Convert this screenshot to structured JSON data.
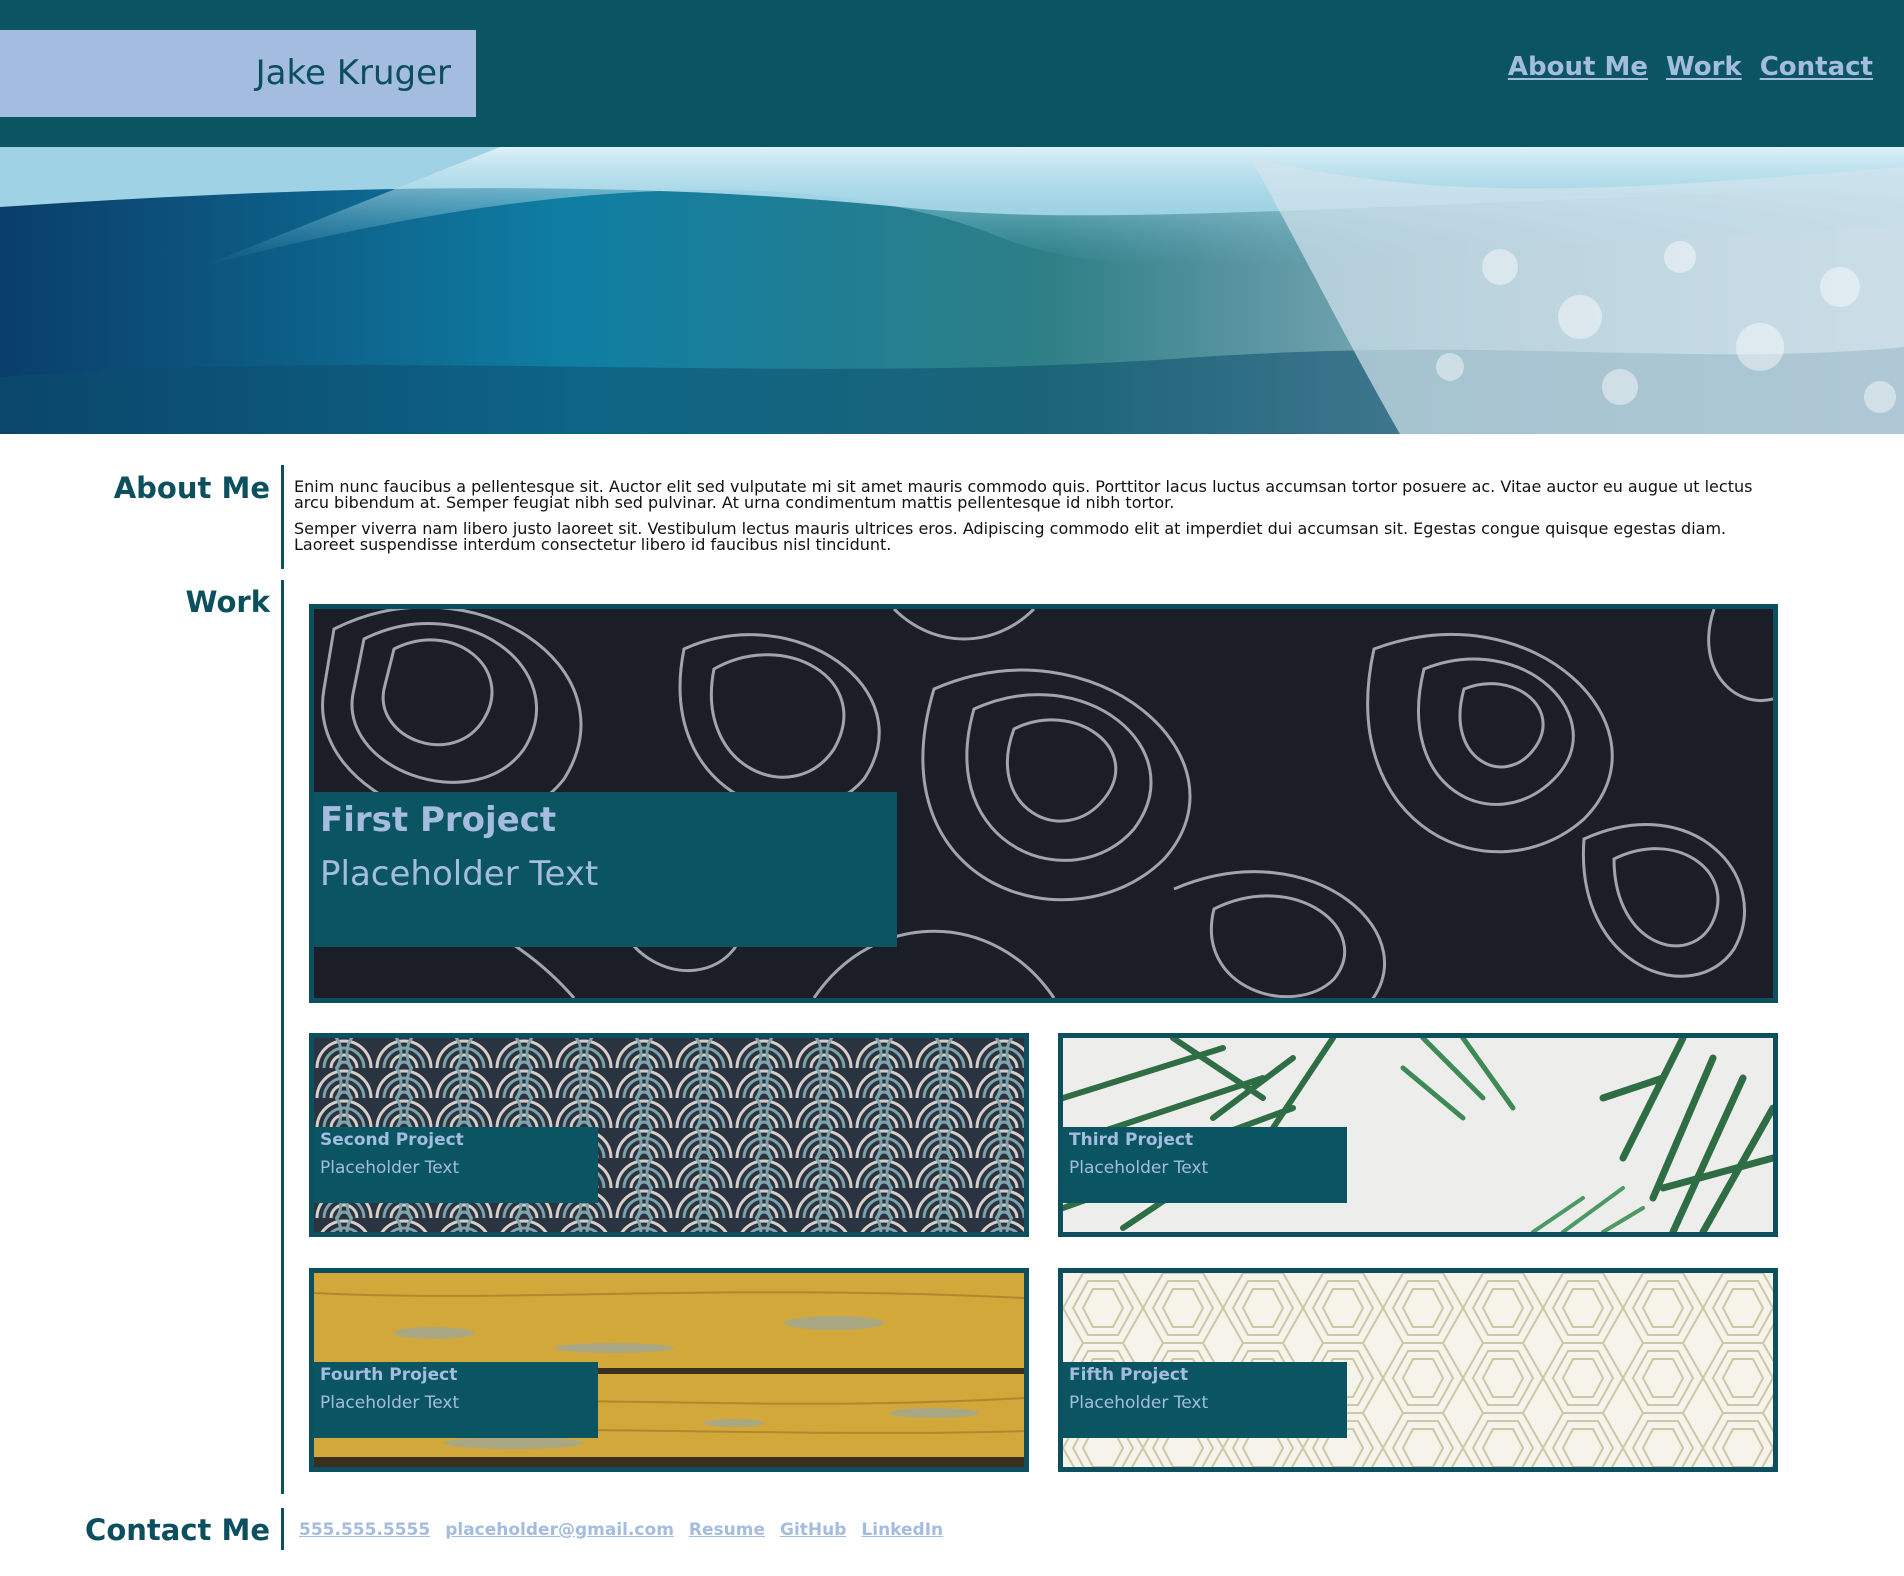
{
  "header": {
    "name": "Jake Kruger",
    "nav": [
      "About Me",
      "Work",
      "Contact"
    ]
  },
  "about": {
    "title": "About Me",
    "paragraphs": [
      "Enim nunc faucibus a pellentesque sit. Auctor elit sed vulputate mi sit amet mauris commodo quis. Porttitor lacus luctus accumsan tortor posuere ac. Vitae auctor eu augue ut lectus arcu bibendum at. Semper feugiat nibh sed pulvinar. At urna condimentum mattis pellentesque id nibh tortor.",
      "Semper viverra nam libero justo laoreet sit. Vestibulum lectus mauris ultrices eros. Adipiscing commodo elit at imperdiet dui accumsan sit. Egestas congue quisque egestas diam. Laoreet suspendisse interdum consectetur libero id faucibus nisl tincidunt."
    ]
  },
  "work": {
    "title": "Work",
    "projects": [
      {
        "title": "First Project",
        "subtitle": "Placeholder Text"
      },
      {
        "title": "Second Project",
        "subtitle": "Placeholder Text"
      },
      {
        "title": "Third Project",
        "subtitle": "Placeholder Text"
      },
      {
        "title": "Fourth Project",
        "subtitle": "Placeholder Text"
      },
      {
        "title": "Fifth Project",
        "subtitle": "Placeholder Text"
      }
    ]
  },
  "contact": {
    "title": "Contact Me",
    "links": [
      "555.555.5555",
      "placeholder@gmail.com",
      "Resume",
      "GitHub",
      "LinkedIn"
    ]
  },
  "colors": {
    "header_bg": "#0b5563",
    "brand_bg": "#a4bcdf",
    "accent": "#0c4f5e",
    "link": "#a4bcdf"
  }
}
